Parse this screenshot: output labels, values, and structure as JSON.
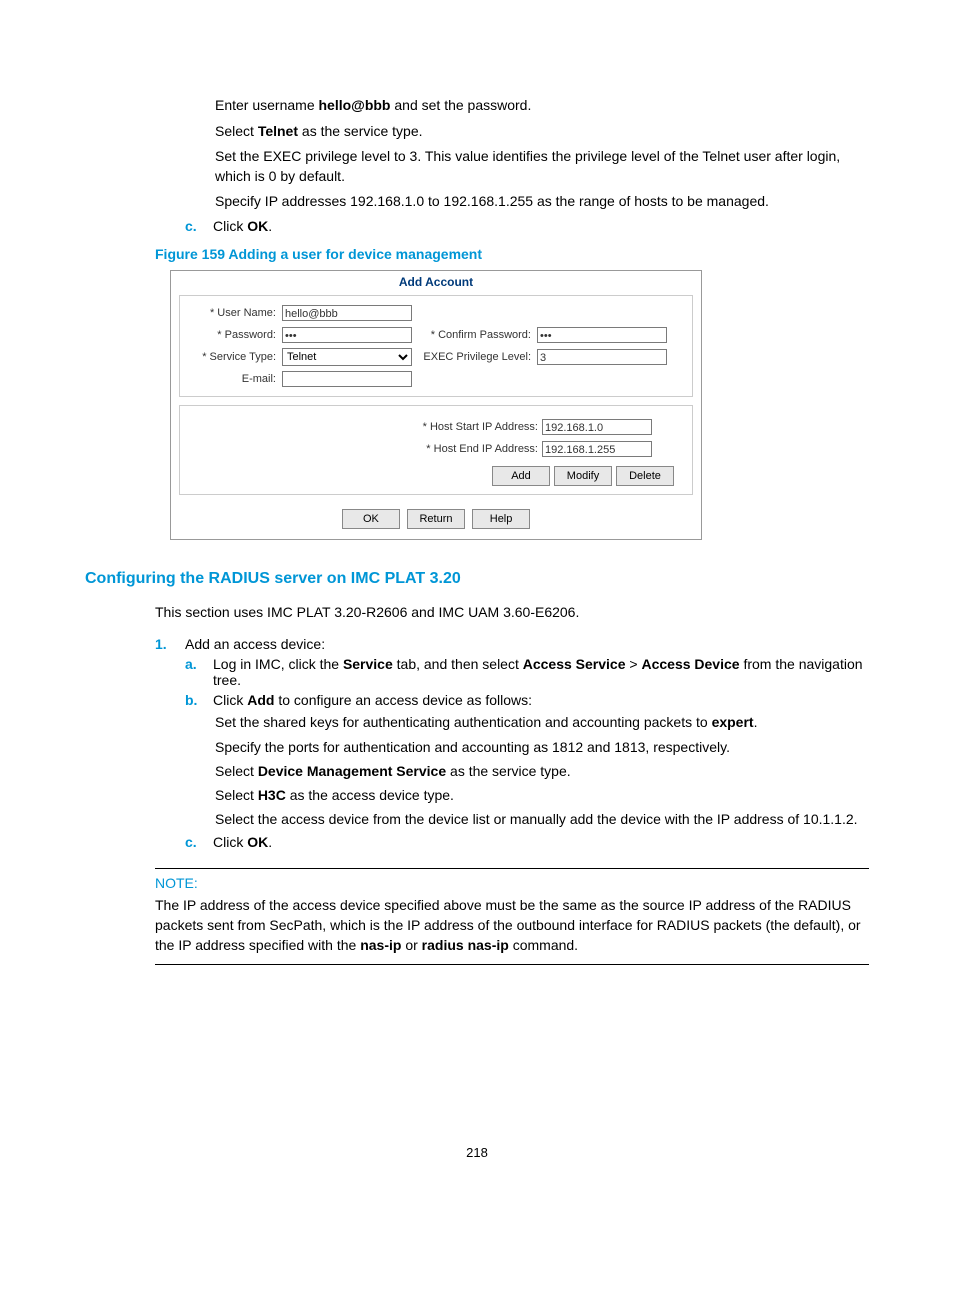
{
  "intro": {
    "p1_pre": "Enter username ",
    "p1_bold": "hello@bbb",
    "p1_post": " and set the password.",
    "p2_pre": "Select ",
    "p2_bold": "Telnet",
    "p2_post": " as the service type.",
    "p3": "Set the EXEC privilege level to 3. This value identifies the privilege level of the Telnet user after login, which is 0 by default.",
    "p4": "Specify IP addresses 192.168.1.0 to 192.168.1.255 as the range of hosts to be managed."
  },
  "stepC": {
    "marker": "c.",
    "text_pre": "Click ",
    "text_bold": "OK",
    "text_post": "."
  },
  "figure": {
    "caption": "Figure 159 Adding a user for device management"
  },
  "shot": {
    "title": "Add Account",
    "labels": {
      "username": "* User Name:",
      "password": "* Password:",
      "servicetype": "* Service Type:",
      "email": "E-mail:",
      "confirm": "* Confirm Password:",
      "execlevel": "EXEC Privilege Level:",
      "hoststart": "* Host Start IP Address:",
      "hostend": "* Host End IP Address:"
    },
    "values": {
      "username": "hello@bbb",
      "password": "•••",
      "servicetype": "Telnet",
      "confirm": "•••",
      "execlevel": "3",
      "hoststart": "192.168.1.0",
      "hostend": "192.168.1.255"
    },
    "buttons": {
      "add": "Add",
      "modify": "Modify",
      "delete": "Delete",
      "ok": "OK",
      "return": "Return",
      "help": "Help"
    }
  },
  "section2": {
    "title": "Configuring the RADIUS server on IMC PLAT 3.20",
    "intro": "This section uses IMC PLAT 3.20-R2606 and IMC UAM 3.60-E6206.",
    "step1": {
      "marker": "1.",
      "text": "Add an access device:"
    },
    "a": {
      "marker": "a.",
      "pre": "Log in IMC, click the ",
      "b1": "Service",
      "mid1": " tab, and then select ",
      "b2": "Access Service",
      "mid2": " > ",
      "b3": "Access Device",
      "post": " from the navigation tree."
    },
    "b": {
      "marker": "b.",
      "pre": "Click ",
      "b1": "Add",
      "post": " to configure an access device as follows:"
    },
    "b_sub1_pre": "Set the shared keys for authenticating authentication and accounting packets to ",
    "b_sub1_bold": "expert",
    "b_sub1_post": ".",
    "b_sub2": "Specify the ports for authentication and accounting as 1812 and 1813, respectively.",
    "b_sub3_pre": "Select ",
    "b_sub3_bold": "Device Management Service",
    "b_sub3_post": " as the service type.",
    "b_sub4_pre": "Select ",
    "b_sub4_bold": "H3C",
    "b_sub4_post": " as the access device type.",
    "b_sub5": "Select the access device from the device list or manually add the device with the IP address of 10.1.1.2.",
    "c": {
      "marker": "c.",
      "pre": "Click ",
      "bold": "OK",
      "post": "."
    }
  },
  "note": {
    "label": "NOTE:",
    "text_pre": "The IP address of the access device specified above must be the same as the source IP address of the RADIUS packets sent from SecPath, which is the IP address of the outbound interface for RADIUS packets (the default), or the IP address specified with the ",
    "b1": "nas-ip",
    "mid": " or ",
    "b2": "radius nas-ip",
    "post": " command."
  },
  "pagenum": "218"
}
